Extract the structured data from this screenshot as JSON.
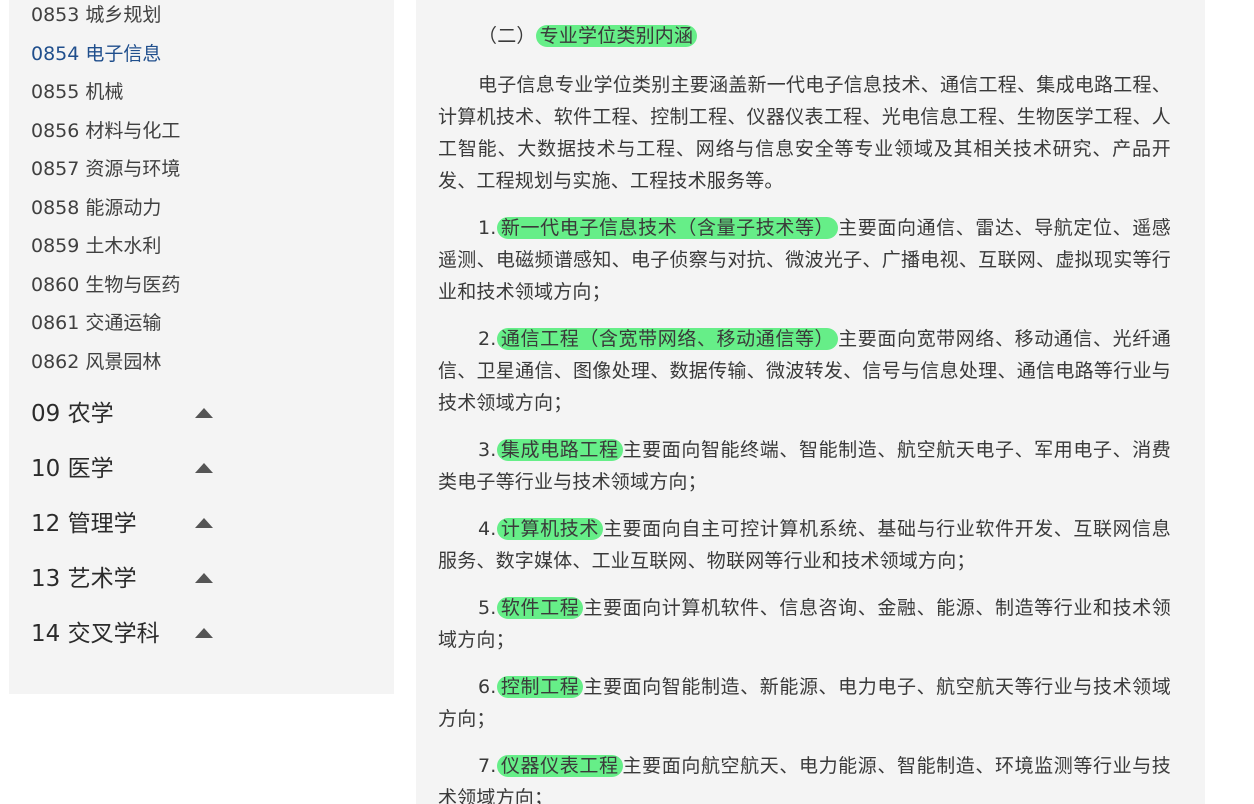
{
  "sidebar": {
    "sub_items": [
      {
        "label": "0853 城乡规划"
      },
      {
        "label": "0854 电子信息"
      },
      {
        "label": "0855 机械"
      },
      {
        "label": "0856 材料与化工"
      },
      {
        "label": "0857 资源与环境"
      },
      {
        "label": "0858 能源动力"
      },
      {
        "label": "0859 土木水利"
      },
      {
        "label": "0860 生物与医药"
      },
      {
        "label": "0861 交通运输"
      },
      {
        "label": "0862 风景园林"
      }
    ],
    "active_index": 1,
    "categories": [
      {
        "label": "09 农学",
        "icon": "chevron-up-icon"
      },
      {
        "label": "10 医学",
        "icon": "chevron-up-icon"
      },
      {
        "label": "12 管理学",
        "icon": "chevron-up-icon"
      },
      {
        "label": "13 艺术学",
        "icon": "chevron-up-icon"
      },
      {
        "label": "14 交叉学科",
        "icon": "chevron-up-icon"
      }
    ]
  },
  "content": {
    "heading_prefix": "（二）",
    "heading_highlight": "专业学位类别内涵",
    "intro": "电子信息专业学位类别主要涵盖新一代电子信息技术、通信工程、集成电路工程、计算机技术、软件工程、控制工程、仪器仪表工程、光电信息工程、生物医学工程、人工智能、大数据技术与工程、网络与信息安全等专业领域及其相关技术研究、产品开发、工程规划与实施、工程技术服务等。",
    "fields": [
      {
        "num": "1.",
        "name": "新一代电子信息技术（含量子技术等）",
        "desc": "主要面向通信、雷达、导航定位、遥感遥测、电磁频谱感知、电子侦察与对抗、微波光子、广播电视、互联网、虚拟现实等行业和技术领域方向；"
      },
      {
        "num": "2.",
        "name": "通信工程（含宽带网络、移动通信等）",
        "desc": "主要面向宽带网络、移动通信、光纤通信、卫星通信、图像处理、数据传输、微波转发、信号与信息处理、通信电路等行业与技术领域方向；"
      },
      {
        "num": "3.",
        "name": "集成电路工程",
        "desc": "主要面向智能终端、智能制造、航空航天电子、军用电子、消费类电子等行业与技术领域方向；"
      },
      {
        "num": "4.",
        "name": "计算机技术",
        "desc": "主要面向自主可控计算机系统、基础与行业软件开发、互联网信息服务、数字媒体、工业互联网、物联网等行业和技术领域方向；"
      },
      {
        "num": "5.",
        "name": "软件工程",
        "desc": "主要面向计算机软件、信息咨询、金融、能源、制造等行业和技术领域方向；"
      },
      {
        "num": "6.",
        "name": "控制工程",
        "desc": "主要面向智能制造、新能源、电力电子、航空航天等行业与技术领域方向；"
      },
      {
        "num": "7.",
        "name": "仪器仪表工程",
        "desc": "主要面向航空航天、电力能源、智能制造、环境监测等行业与技术领域方向；"
      }
    ]
  },
  "colors": {
    "highlight": "#66ee88",
    "active_link": "#1f4e8c",
    "panel_bg": "#f4f4f4"
  }
}
